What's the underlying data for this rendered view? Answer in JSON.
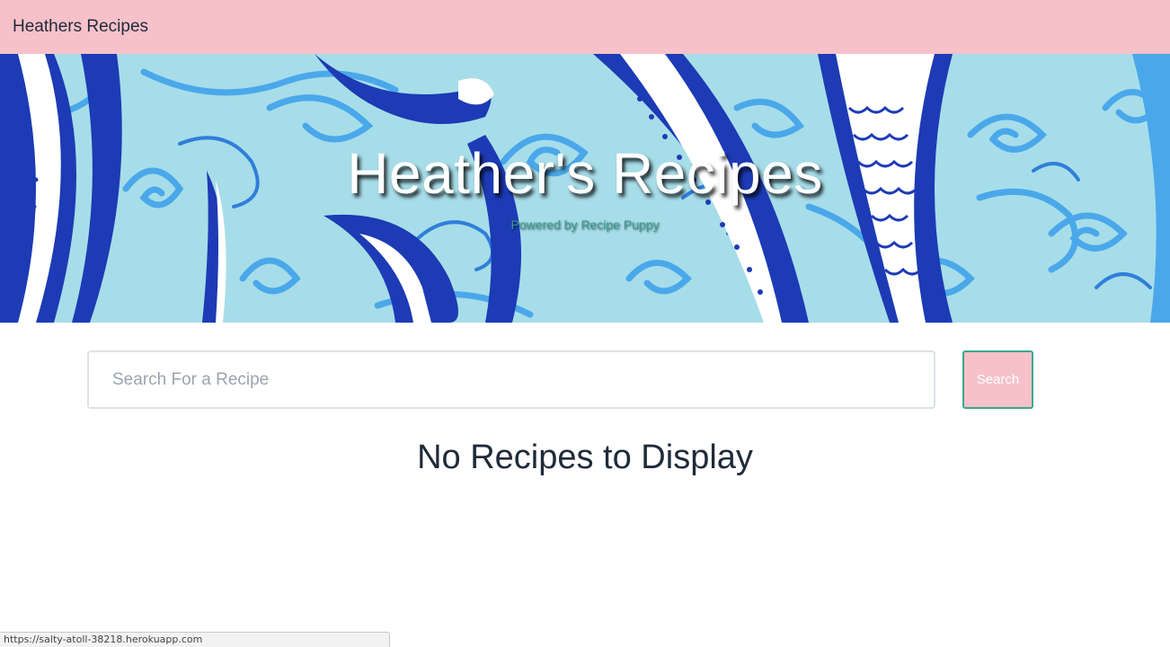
{
  "navbar": {
    "brand": "Heathers Recipes"
  },
  "hero": {
    "title": "Heather's Recipes",
    "subtitle": "Powered by Recipe Puppy",
    "background_image": "blue-white-mermaid-wave-pattern"
  },
  "search": {
    "placeholder": "Search For a Recipe",
    "value": "",
    "button_label": "Search"
  },
  "results": {
    "empty_message": "No Recipes to Display"
  },
  "status_bar": {
    "url": "https://salty-atoll-38218.herokuapp.com"
  },
  "colors": {
    "navbar_bg": "#f6c1c9",
    "hero_light_blue": "#a7dde9",
    "hero_mid_blue": "#4aa8ea",
    "hero_dark_blue": "#1c3bb5",
    "button_border": "#3aa88d",
    "text_dark": "#1f2a3a"
  }
}
